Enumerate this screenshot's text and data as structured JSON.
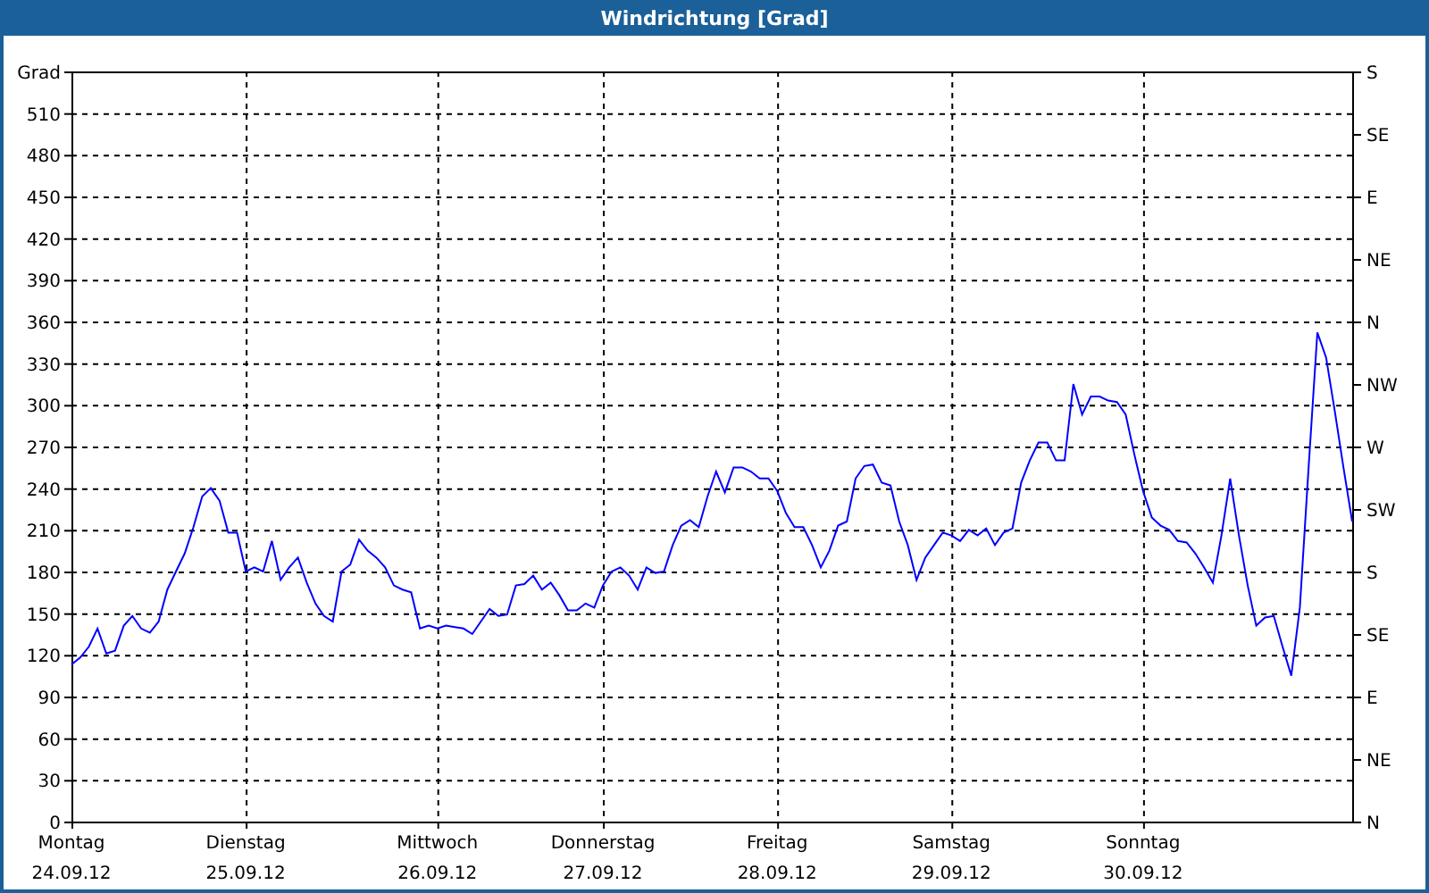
{
  "window": {
    "title": "Windrichtung [Grad]"
  },
  "chart": {
    "chart_data": {
      "type": "line",
      "grid": true,
      "ylabel": "Grad",
      "ylim": [
        0,
        540
      ],
      "categories": [
        "Montag",
        null,
        null,
        null,
        null,
        null,
        null,
        null,
        null,
        null,
        null,
        null,
        null,
        null,
        null,
        null,
        null,
        null,
        null,
        null,
        "Dienstag",
        null,
        null,
        null,
        null,
        null,
        null,
        null,
        null,
        null,
        null,
        null,
        null,
        null,
        null,
        null,
        null,
        null,
        null,
        null,
        null,
        null,
        "Mittwoch",
        null,
        null,
        null,
        null,
        null,
        null,
        null,
        null,
        null,
        null,
        null,
        null,
        null,
        null,
        null,
        null,
        null,
        null,
        "Donnerstag",
        null,
        null,
        null,
        null,
        null,
        null,
        null,
        null,
        null,
        null,
        null,
        null,
        null,
        null,
        null,
        null,
        null,
        null,
        null,
        "Freitag",
        null,
        null,
        null,
        null,
        null,
        null,
        null,
        null,
        null,
        null,
        null,
        null,
        null,
        null,
        null,
        null,
        null,
        null,
        null,
        "Samstag",
        null,
        null,
        null,
        null,
        null,
        null,
        null,
        null,
        null,
        null,
        null,
        null,
        null,
        null,
        null,
        null,
        null,
        null,
        null,
        null,
        null,
        "Sonntag",
        null,
        null,
        null,
        null,
        null,
        null,
        null,
        null,
        null,
        null,
        null,
        null,
        null,
        null,
        null,
        null,
        null,
        null,
        null,
        null,
        null,
        null,
        null,
        null
      ],
      "yticks": [
        0,
        30,
        60,
        90,
        120,
        150,
        180,
        210,
        240,
        270,
        300,
        330,
        360,
        390,
        420,
        450,
        480,
        510
      ],
      "series": [
        {
          "color": "#0000ff",
          "values": [
            113,
            118,
            126,
            139,
            121,
            123,
            141,
            148,
            139,
            136,
            144,
            167,
            180,
            193,
            212,
            234,
            240,
            231,
            208,
            208,
            180,
            183,
            180,
            202,
            174,
            183,
            190,
            172,
            157,
            148,
            144,
            180,
            185,
            203,
            195,
            190,
            183,
            170,
            167,
            165,
            139,
            141,
            139,
            141,
            140,
            139,
            135,
            144,
            153,
            148,
            149,
            170,
            171,
            177,
            167,
            172,
            163,
            152,
            152,
            157,
            154,
            170,
            180,
            183,
            177,
            167,
            183,
            179,
            180,
            199,
            213,
            217,
            212,
            234,
            252,
            237,
            255,
            255,
            252,
            247,
            247,
            238,
            222,
            212,
            212,
            199,
            183,
            195,
            213,
            216,
            247,
            256,
            257,
            244,
            242,
            216,
            199,
            174,
            190,
            199,
            208,
            206,
            202,
            210,
            206,
            211,
            199,
            208,
            211,
            244,
            260,
            273,
            273,
            260,
            260,
            315,
            293,
            306,
            306,
            303,
            302,
            293,
            264,
            238,
            219,
            213,
            210,
            202,
            201,
            193,
            183,
            172,
            206,
            247,
            206,
            170,
            141,
            147,
            148,
            126,
            105,
            154,
            255,
            352,
            334,
            296,
            255,
            216
          ]
        }
      ]
    },
    "dates": [
      "24.09.12",
      "25.09.12",
      "26.09.12",
      "27.09.12",
      "28.09.12",
      "29.09.12",
      "30.09.12"
    ],
    "right_axis_labels": [
      "S",
      "SE",
      "E",
      "NE",
      "N",
      "NW",
      "W",
      "SW",
      "S",
      "SE",
      "E",
      "NE",
      "N"
    ]
  }
}
